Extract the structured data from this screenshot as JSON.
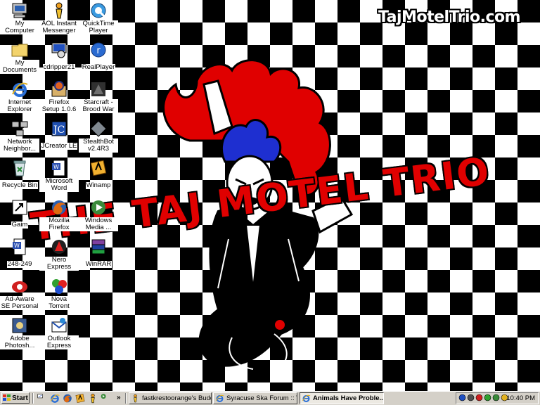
{
  "wallpaper": {
    "site_text": "TajMotelTrio.com",
    "band_text": "THE TAJ MOTEL TRIO"
  },
  "icons": [
    {
      "label": "My Computer",
      "icon": "computer-icon",
      "col": 0,
      "row": 0
    },
    {
      "label": "My Documents",
      "icon": "folder-icon",
      "col": 0,
      "row": 1
    },
    {
      "label": "Internet Explorer",
      "icon": "ie-icon",
      "col": 0,
      "row": 2
    },
    {
      "label": "Network Neighbor...",
      "icon": "network-icon",
      "col": 0,
      "row": 3
    },
    {
      "label": "Recycle Bin",
      "icon": "recycle-bin-icon",
      "col": 0,
      "row": 4
    },
    {
      "label": "Gaim",
      "icon": "shortcut-icon",
      "col": 0,
      "row": 5
    },
    {
      "label": "248-249",
      "icon": "word-doc-icon",
      "col": 0,
      "row": 6
    },
    {
      "label": "Ad-Aware SE Personal",
      "icon": "adaware-icon",
      "col": 0,
      "row": 7
    },
    {
      "label": "Adobe Photosh...",
      "icon": "photoshop-icon",
      "col": 0,
      "row": 8
    },
    {
      "label": "AOL Instant Messenger",
      "icon": "aim-icon",
      "col": 1,
      "row": 0
    },
    {
      "label": "cdripper21",
      "icon": "program-icon",
      "col": 1,
      "row": 1
    },
    {
      "label": "Firefox Setup 1.0.6",
      "icon": "installer-icon",
      "col": 1,
      "row": 2
    },
    {
      "label": "JCreator LE",
      "icon": "jcreator-icon",
      "col": 1,
      "row": 3
    },
    {
      "label": "Microsoft Word",
      "icon": "word-icon",
      "col": 1,
      "row": 4
    },
    {
      "label": "Mozilla Firefox",
      "icon": "firefox-icon",
      "col": 1,
      "row": 5
    },
    {
      "label": "Nero Express",
      "icon": "nero-icon",
      "col": 1,
      "row": 6
    },
    {
      "label": "Nova Torrent",
      "icon": "torrent-icon",
      "col": 1,
      "row": 7
    },
    {
      "label": "Outlook Express",
      "icon": "outlook-icon",
      "col": 1,
      "row": 8
    },
    {
      "label": "QuickTime Player",
      "icon": "quicktime-icon",
      "col": 2,
      "row": 0
    },
    {
      "label": "RealPlayer",
      "icon": "realplayer-icon",
      "col": 2,
      "row": 1
    },
    {
      "label": "Starcraft - Brood War",
      "icon": "starcraft-icon",
      "col": 2,
      "row": 2
    },
    {
      "label": "StealthBot v2.4R3",
      "icon": "stealthbot-icon",
      "col": 2,
      "row": 3
    },
    {
      "label": "Winamp",
      "icon": "winamp-icon",
      "col": 2,
      "row": 4
    },
    {
      "label": "Windows Media ...",
      "icon": "wmp-icon",
      "col": 2,
      "row": 5
    },
    {
      "label": "WinRAR",
      "icon": "winrar-icon",
      "col": 2,
      "row": 6
    }
  ],
  "taskbar": {
    "start_label": "Start",
    "chevron": "»",
    "quicklaunch": [
      "show-desktop-icon",
      "ie-icon",
      "firefox-icon",
      "winamp-icon",
      "aim-icon",
      "media-icon"
    ],
    "tasks": [
      {
        "label": "fastkrestoorange's Buddy ...",
        "icon": "aim-icon",
        "active": false
      },
      {
        "label": "Syracuse Ska Forum :: Vie...",
        "icon": "ie-icon",
        "active": false
      },
      {
        "label": "Animals Have Proble...",
        "icon": "ie-icon",
        "active": true
      }
    ],
    "clock": "10:40 PM"
  },
  "colors": {
    "taskbar": "#d4d0c8",
    "accent_red": "#e00000",
    "band_blue": "#1e2fd0"
  }
}
